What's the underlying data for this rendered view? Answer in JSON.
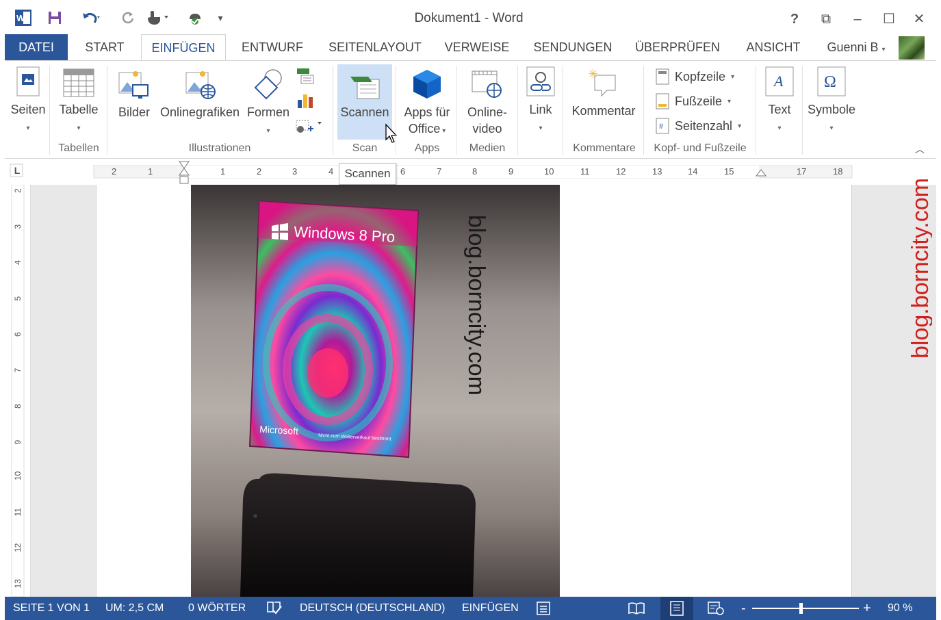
{
  "window": {
    "title": "Dokument1 - Word",
    "user": "Guenni B",
    "help": "?",
    "ribbon_display": "⧉",
    "minimize": "–",
    "maximize": "☐",
    "close": "✕"
  },
  "quick_access": {
    "word_logo": "W",
    "save": "💾",
    "undo": "↶",
    "redo": "↻",
    "touch": "☝",
    "customize": "⚙"
  },
  "tabs": [
    "DATEI",
    "START",
    "EINFÜGEN",
    "ENTWURF",
    "SEITENLAYOUT",
    "VERWEISE",
    "SENDUNGEN",
    "ÜBERPRÜFEN",
    "ANSICHT"
  ],
  "ribbon": {
    "seiten": "Seiten",
    "tabelle": "Tabelle",
    "bilder": "Bilder",
    "onlinegrafiken": "Onlinegrafiken",
    "formen": "Formen",
    "scannen": "Scannen",
    "apps_line1": "Apps für",
    "apps_line2": "Office",
    "online_line1": "Online-",
    "online_line2": "video",
    "link": "Link",
    "kommentar": "Kommentar",
    "kopfzeile": "Kopfzeile",
    "fusszeile": "Fußzeile",
    "seitenzahl": "Seitenzahl",
    "text": "Text",
    "symbole": "Symbole",
    "groups": {
      "tabellen": "Tabellen",
      "illustrationen": "Illustrationen",
      "scan": "Scan",
      "apps": "Apps",
      "medien": "Medien",
      "kommentare": "Kommentare",
      "kopf_fusszeile": "Kopf- und Fußzeile"
    }
  },
  "ruler": {
    "tab_selector": "L",
    "ticks": [
      "2",
      "1",
      "1",
      "2",
      "3",
      "4",
      "6",
      "7",
      "8",
      "9",
      "10",
      "11",
      "12",
      "13",
      "14",
      "15",
      "17",
      "18"
    ],
    "vticks": [
      "2",
      "3",
      "4",
      "5",
      "6",
      "7",
      "8",
      "9",
      "10",
      "11",
      "12",
      "13"
    ]
  },
  "tooltip": "Scannen",
  "document": {
    "box_brand": "Windows 8 Pro",
    "box_vendor": "Microsoft",
    "box_note": "Nicht zum Weiterverkauf bestimmt",
    "watermark": "blog.borncity.com",
    "side_watermark": "blog.borncity.com"
  },
  "status": {
    "page": "SEITE 1 VON 1",
    "position": "UM: 2,5 CM",
    "words": "0 WÖRTER",
    "language": "DEUTSCH (DEUTSCHLAND)",
    "mode": "EINFÜGEN",
    "zoom_minus": "-",
    "zoom_plus": "+",
    "zoom": "90 %"
  },
  "colors": {
    "accent": "#2b579a",
    "watermark_red": "#d0201d"
  }
}
